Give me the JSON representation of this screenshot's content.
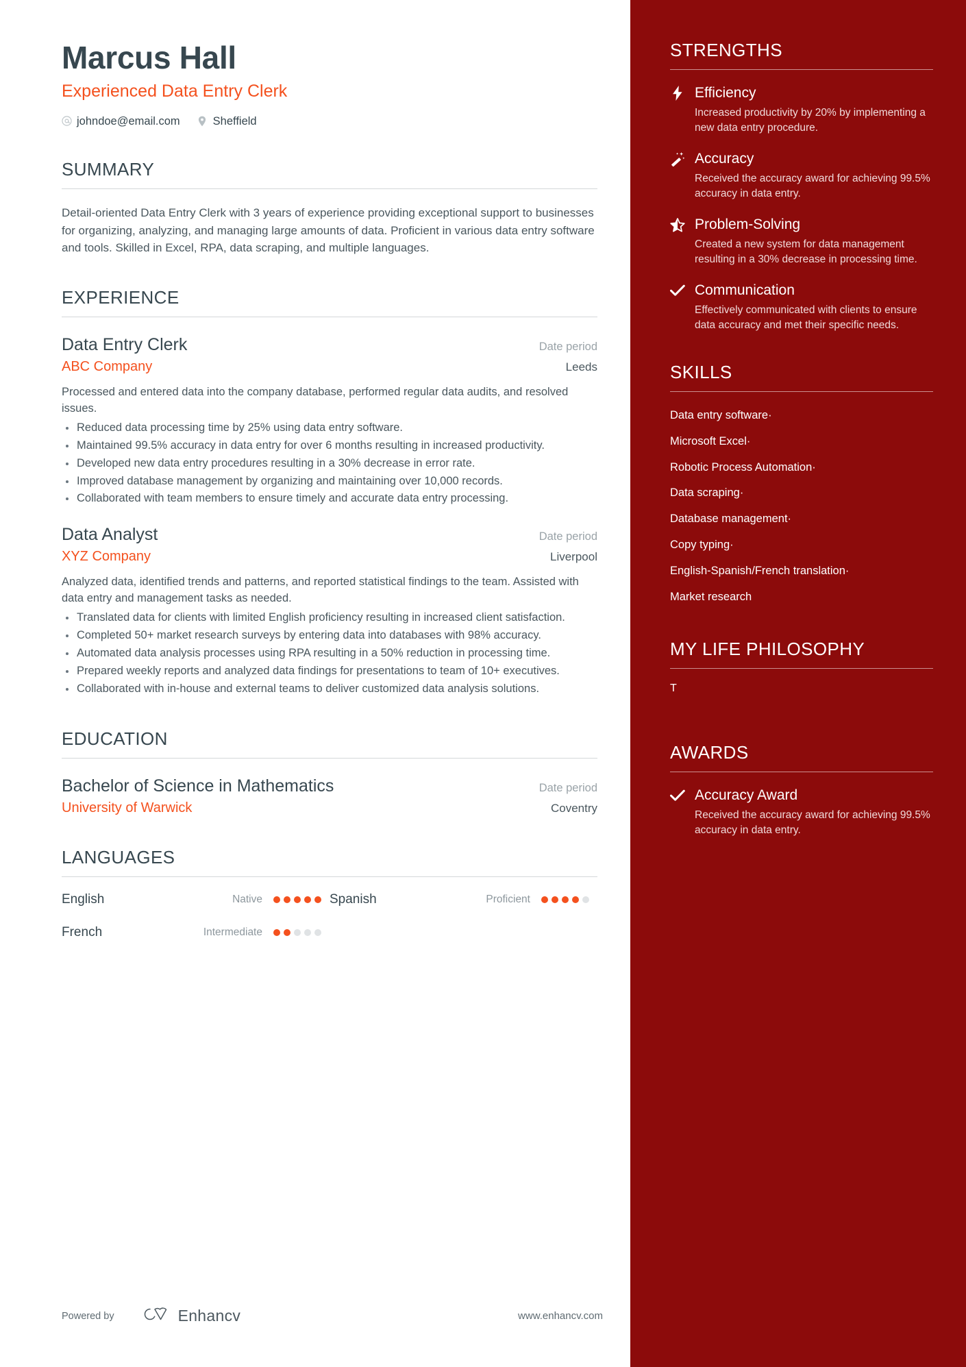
{
  "header": {
    "name": "Marcus Hall",
    "job_title": "Experienced Data Entry Clerk",
    "email": "johndoe@email.com",
    "location": "Sheffield",
    "email_icon": "at-sign-icon",
    "location_icon": "map-pin-icon"
  },
  "summary": {
    "title": "SUMMARY",
    "text": "Detail-oriented Data Entry Clerk with 3 years of experience providing exceptional support to businesses for organizing, analyzing, and managing large amounts of data. Proficient in various data entry software and tools. Skilled in Excel, RPA, data scraping, and multiple languages."
  },
  "experience": {
    "title": "EXPERIENCE",
    "entries": [
      {
        "role": "Data Entry Clerk",
        "date": "Date period",
        "company": "ABC Company",
        "location": "Leeds",
        "description": "Processed and entered data into the company database, performed regular data audits, and resolved issues.",
        "bullets": [
          "Reduced data processing time by 25% using data entry software.",
          "Maintained 99.5% accuracy in data entry for over 6 months resulting in increased productivity.",
          "Developed new data entry procedures resulting in a 30% decrease in error rate.",
          "Improved database management by organizing and maintaining over 10,000 records.",
          "Collaborated with team members to ensure timely and accurate data entry processing."
        ]
      },
      {
        "role": "Data Analyst",
        "date": "Date period",
        "company": "XYZ Company",
        "location": "Liverpool",
        "description": "Analyzed data, identified trends and patterns, and reported statistical findings to the team. Assisted with data entry and management tasks as needed.",
        "bullets": [
          "Translated data for clients with limited English proficiency resulting in increased client satisfaction.",
          "Completed 50+ market research surveys by entering data into databases with 98% accuracy.",
          "Automated data analysis processes using RPA resulting in a 50% reduction in processing time.",
          "Prepared weekly reports and analyzed data findings for presentations to team of 10+ executives.",
          "Collaborated with in-house and external teams to deliver customized data analysis solutions."
        ]
      }
    ]
  },
  "education": {
    "title": "EDUCATION",
    "entries": [
      {
        "degree": "Bachelor of Science in Mathematics",
        "date": "Date period",
        "school": "University of Warwick",
        "location": "Coventry"
      }
    ]
  },
  "languages": {
    "title": "LANGUAGES",
    "items": [
      {
        "name": "English",
        "level": "Native",
        "rating": 5,
        "max": 5
      },
      {
        "name": "Spanish",
        "level": "Proficient",
        "rating": 4,
        "max": 5
      },
      {
        "name": "French",
        "level": "Intermediate",
        "rating": 2,
        "max": 5
      }
    ]
  },
  "footer": {
    "powered_by": "Powered by",
    "brand": "Enhancv",
    "url": "www.enhancv.com",
    "logo_icon": "enhancv-logo-icon"
  },
  "strengths": {
    "title": "STRENGTHS",
    "items": [
      {
        "name": "Efficiency",
        "icon": "lightning-bolt-icon",
        "description": "Increased productivity by 20% by implementing a new data entry procedure."
      },
      {
        "name": "Accuracy",
        "icon": "magic-wand-icon",
        "description": "Received the accuracy award for achieving 99.5% accuracy in data entry."
      },
      {
        "name": "Problem-Solving",
        "icon": "half-star-icon",
        "description": "Created a new system for data management resulting in a 30% decrease in processing time."
      },
      {
        "name": "Communication",
        "icon": "checkmark-icon",
        "description": "Effectively communicated with clients to ensure data accuracy and met their specific needs."
      }
    ]
  },
  "skills": {
    "title": "SKILLS",
    "items": [
      {
        "label": "Data entry software",
        "separator": "·"
      },
      {
        "label": "Microsoft Excel",
        "separator": "·"
      },
      {
        "label": "Robotic Process Automation",
        "separator": "·"
      },
      {
        "label": "Data scraping",
        "separator": "·"
      },
      {
        "label": "Database management",
        "separator": "·"
      },
      {
        "label": "Copy typing",
        "separator": "·"
      },
      {
        "label": "English-Spanish/French translation",
        "separator": "·"
      },
      {
        "label": "Market research",
        "separator": ""
      }
    ]
  },
  "philosophy": {
    "title": "MY LIFE PHILOSOPHY",
    "text": "T"
  },
  "awards": {
    "title": "AWARDS",
    "items": [
      {
        "name": "Accuracy Award",
        "icon": "checkmark-icon",
        "description": "Received the accuracy award for achieving 99.5% accuracy in data entry."
      }
    ]
  },
  "colors": {
    "accent": "#f4511e",
    "sidebar_bg": "#8c0b0b",
    "heading": "#37474f",
    "body_text": "#4a575e"
  }
}
